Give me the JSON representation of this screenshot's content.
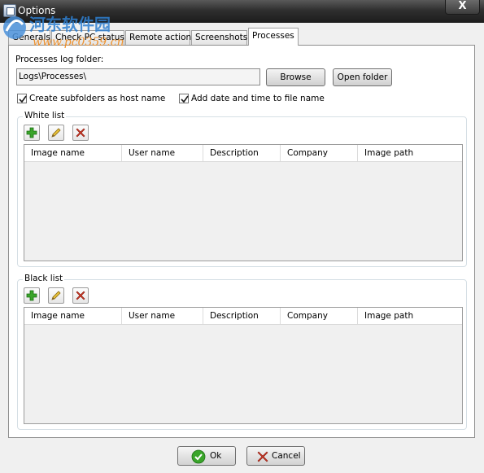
{
  "window": {
    "title": "Options",
    "close_symbol": "X",
    "watermark_line1": "河东软件园",
    "watermark_line2": "www.pc0359.cn"
  },
  "tabs": [
    {
      "label": "Generals"
    },
    {
      "label": "Check PC status"
    },
    {
      "label": "Remote action"
    },
    {
      "label": "Screenshots"
    },
    {
      "label": "Processes",
      "active": true
    }
  ],
  "processes": {
    "log_folder_label": "Processes log folder:",
    "log_folder_value": "Logs\\Processes\\",
    "browse_label": "Browse",
    "open_folder_label": "Open folder",
    "subfolders_checkbox": {
      "label": "Create subfolders as host name",
      "checked": true
    },
    "datetime_checkbox": {
      "label": "Add date and time to file name",
      "checked": true
    }
  },
  "white_list": {
    "title": "White list",
    "toolbar_icons": [
      "add-icon",
      "edit-icon",
      "delete-icon"
    ],
    "columns": [
      "Image name",
      "User name",
      "Description",
      "Company",
      "Image path"
    ],
    "rows": []
  },
  "black_list": {
    "title": "Black list",
    "toolbar_icons": [
      "add-icon",
      "edit-icon",
      "delete-icon"
    ],
    "columns": [
      "Image name",
      "User name",
      "Description",
      "Company",
      "Image path"
    ],
    "rows": []
  },
  "footer": {
    "ok_label": "Ok",
    "cancel_label": "Cancel"
  },
  "colors": {
    "titlebar": "#2f2f2f",
    "add_green": "#3aa52a",
    "delete_red": "#d23a24",
    "edit_yellow": "#e8c23a"
  }
}
